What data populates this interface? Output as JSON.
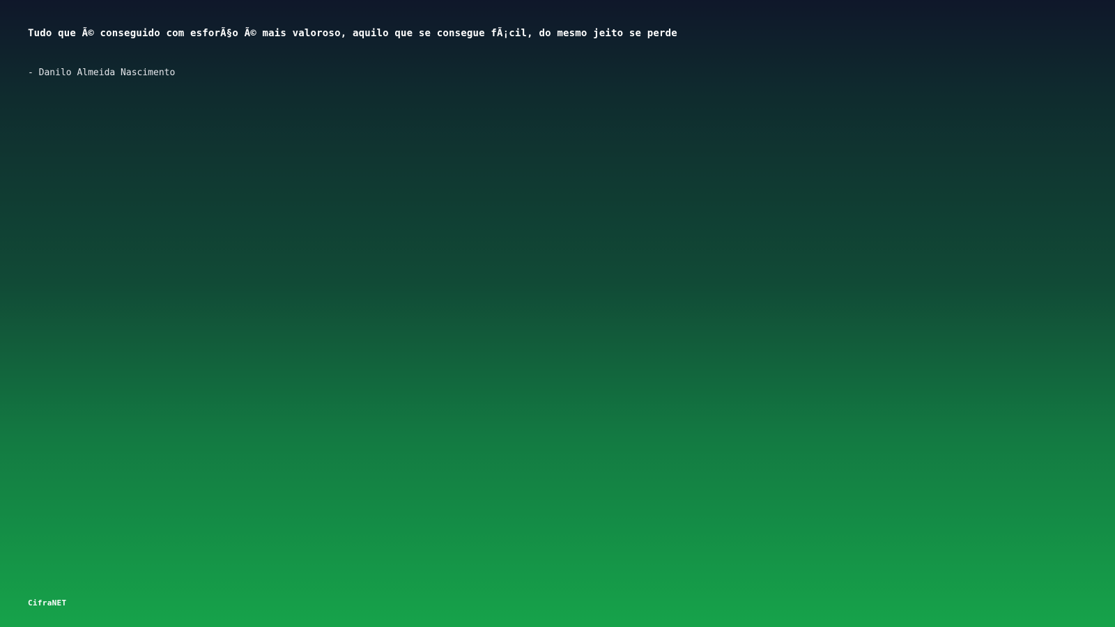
{
  "quote": {
    "text": "Tudo que Ã© conseguido com esforÃ§o Ã© mais valoroso, aquilo que se consegue fÃ¡cil, do mesmo jeito se perde",
    "author": "- Danilo Almeida Nascimento"
  },
  "brand": {
    "name": "CifraNET"
  },
  "colors": {
    "gradient_top": "#0f172a",
    "gradient_bottom": "#16a34a",
    "text": "#ffffff"
  }
}
